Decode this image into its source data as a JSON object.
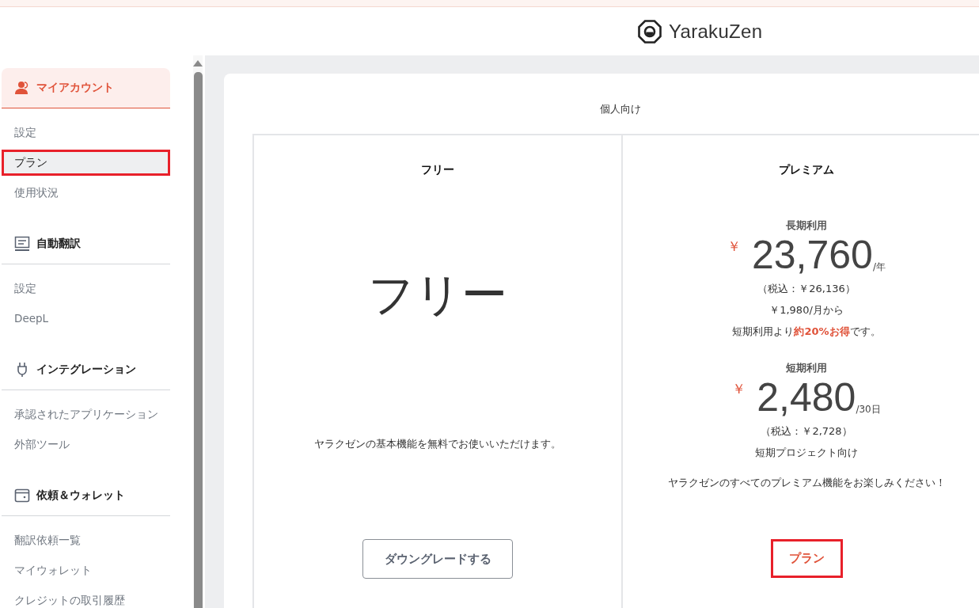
{
  "logo": {
    "text": "YarakuZen"
  },
  "sidebar": {
    "sections": [
      {
        "kind": "account",
        "title": "マイアカウント",
        "active": true,
        "items": [
          {
            "label": "設定",
            "selected": false,
            "annotated": false
          },
          {
            "label": "プラン",
            "selected": true,
            "annotated": true
          },
          {
            "label": "使用状況",
            "selected": false,
            "annotated": false
          }
        ]
      },
      {
        "kind": "translate",
        "title": "自動翻訳",
        "active": false,
        "items": [
          {
            "label": "設定",
            "selected": false,
            "annotated": false
          },
          {
            "label": "DeepL",
            "selected": false,
            "annotated": false
          }
        ]
      },
      {
        "kind": "plug",
        "title": "インテグレーション",
        "active": false,
        "items": [
          {
            "label": "承認されたアプリケーション",
            "selected": false,
            "annotated": false
          },
          {
            "label": "外部ツール",
            "selected": false,
            "annotated": false
          }
        ]
      },
      {
        "kind": "wallet",
        "title": "依頼＆ウォレット",
        "active": false,
        "items": [
          {
            "label": "翻訳依頼一覧",
            "selected": false,
            "annotated": false
          },
          {
            "label": "マイウォレット",
            "selected": false,
            "annotated": false
          },
          {
            "label": "クレジットの取引履歴",
            "selected": false,
            "annotated": false
          }
        ]
      }
    ]
  },
  "content": {
    "heading": "個人向け",
    "plans": [
      {
        "kind": "free",
        "name": "フリー",
        "headline": "フリー",
        "description": "ヤラクゼンの基本機能を無料でお使いいただけます。",
        "button": {
          "label": "ダウングレードする",
          "kind": "outline",
          "annotated": false
        }
      },
      {
        "kind": "premium",
        "name": "プレミアム",
        "prices": [
          {
            "label": "長期利用",
            "currency": "￥",
            "amount": "23,760",
            "unit": "/年",
            "notes": [
              "（税込：￥26,136）",
              "￥1,980/月から",
              "短期利用より**約20%お得**です。"
            ]
          },
          {
            "label": "短期利用",
            "currency": "￥",
            "amount": "2,480",
            "unit": "/30日",
            "notes": [
              "（税込：￥2,728）",
              "短期プロジェクト向け"
            ]
          }
        ],
        "description": "ヤラクゼンのすべてのプレミアム機能をお楽しみください！",
        "button": {
          "label": "プラン",
          "kind": "text",
          "annotated": true
        }
      }
    ]
  }
}
